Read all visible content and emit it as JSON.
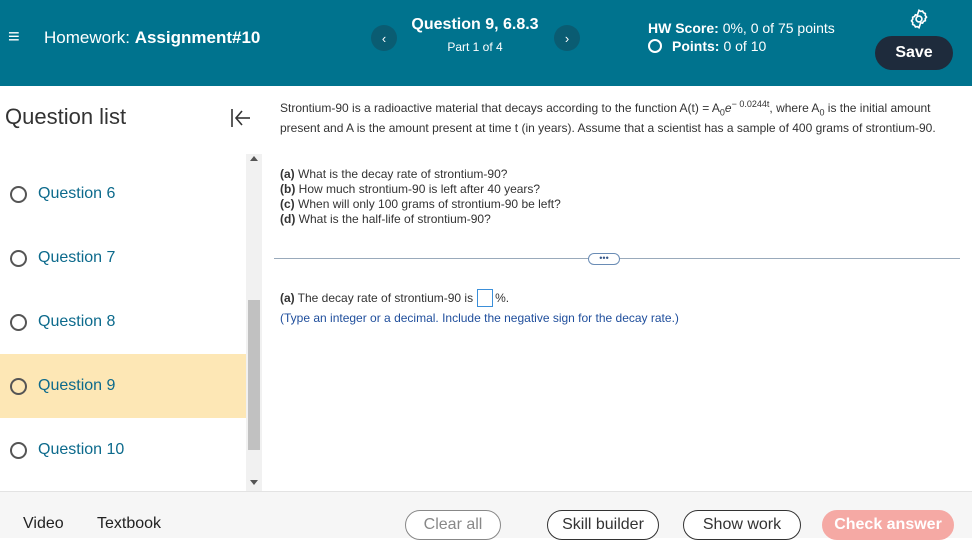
{
  "header": {
    "hw_prefix": "Homework:",
    "hw_name": "Assignment#10",
    "question_title": "Question 9, 6.8.3",
    "question_part": "Part 1 of 4",
    "hw_score_label": "HW Score:",
    "hw_score_value": "0%, 0 of 75 points",
    "points_label": "Points:",
    "points_value": "0 of 10",
    "save_label": "Save",
    "prev_glyph": "‹",
    "next_glyph": "›",
    "menu_glyph": "≡"
  },
  "sidebar": {
    "title": "Question list",
    "items": [
      {
        "label": "Question 6"
      },
      {
        "label": "Question 7"
      },
      {
        "label": "Question 8"
      },
      {
        "label": "Question 9"
      },
      {
        "label": "Question 10"
      }
    ]
  },
  "problem": {
    "intro_1": "Strontium-90 is a radioactive material that decays according to the function A(t) = A",
    "sub_0": "0",
    "e": "e",
    "exponent": "− 0.0244t",
    "intro_2": ", where A",
    "intro_3": " is the initial amount present and A is the amount present at time t (in years). Assume that a scientist has a sample of 400 grams of strontium-90.",
    "parts": [
      {
        "tag": "(a)",
        "text": "What is the decay rate of strontium-90?"
      },
      {
        "tag": "(b)",
        "text": "How much strontium-90 is left after 40 years?"
      },
      {
        "tag": "(c)",
        "text": "When will only 100 grams of strontium-90 be left?"
      },
      {
        "tag": "(d)",
        "text": "What is the half-life of strontium-90?"
      }
    ],
    "more_label": "•••",
    "answer_tag": "(a)",
    "answer_text": "The decay rate of strontium-90 is",
    "answer_unit": "%.",
    "hint": "(Type an integer or a decimal. Include the negative sign for the decay rate.)"
  },
  "footer": {
    "video": "Video",
    "textbook": "Textbook",
    "clear": "Clear all",
    "skill": "Skill builder",
    "show": "Show work",
    "check": "Check answer"
  },
  "colors": {
    "header_bg": "#00738e",
    "active_item_bg": "#fde7b5",
    "link_blue": "#0c6a8c",
    "check_answer_bg": "#f5a9a4"
  }
}
